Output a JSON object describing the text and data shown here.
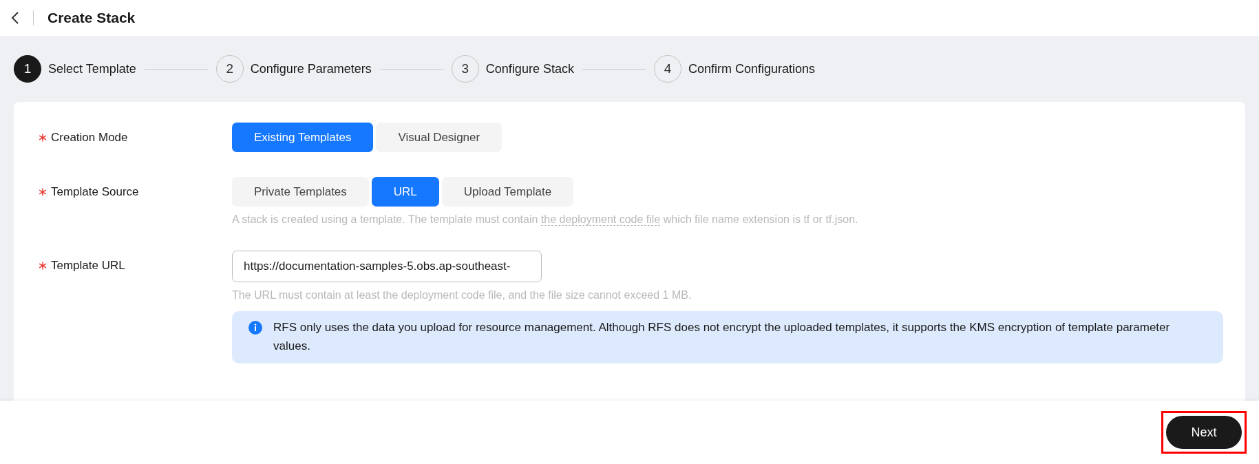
{
  "header": {
    "title": "Create Stack"
  },
  "steps": [
    {
      "number": "1",
      "label": "Select Template",
      "selected": true
    },
    {
      "number": "2",
      "label": "Configure Parameters",
      "selected": false
    },
    {
      "number": "3",
      "label": "Configure Stack",
      "selected": false
    },
    {
      "number": "4",
      "label": "Confirm Configurations",
      "selected": false
    }
  ],
  "form": {
    "rows": [
      {
        "kind": "segments",
        "label": "Creation Mode",
        "required": true,
        "options": [
          {
            "label": "Existing Templates",
            "selected": true
          },
          {
            "label": "Visual Designer",
            "selected": false
          }
        ]
      },
      {
        "kind": "segments",
        "label": "Template Source",
        "required": true,
        "options": [
          {
            "label": "Private Templates",
            "selected": false
          },
          {
            "label": "URL",
            "selected": true
          },
          {
            "label": "Upload Template",
            "selected": false
          }
        ],
        "hint": {
          "before": "A stack is created using a template. The template must contain ",
          "link": "the deployment code file",
          "after": " which file name extension is tf or tf.json."
        }
      },
      {
        "kind": "input",
        "label": "Template URL",
        "required": true,
        "value": "https://documentation-samples-5.obs.ap-southeast-",
        "hint": {
          "before": "The URL must contain at least the deployment code file, and the file size cannot exceed 1 MB."
        },
        "notice": "RFS only uses the data you upload for resource management. Although RFS does not encrypt the uploaded templates, it supports the KMS encryption of template parameter values."
      }
    ]
  },
  "footer": {
    "next_button": {
      "label": "Next",
      "highlighted": true
    }
  }
}
